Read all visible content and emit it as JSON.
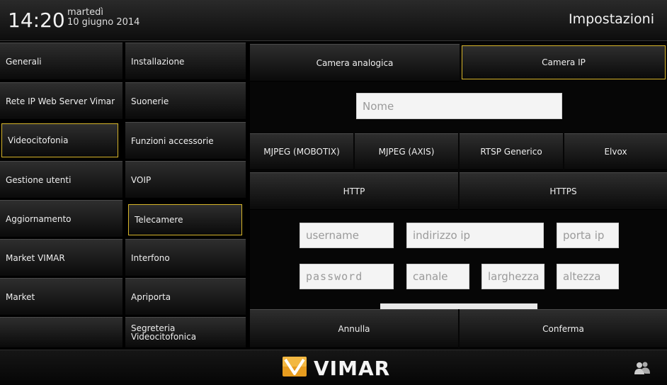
{
  "header": {
    "time": "14:20",
    "day_of_week": "martedì",
    "date": "10 giugno 2014",
    "title": "Impostazioni"
  },
  "menu_col1": [
    "Generali",
    "Rete IP Web Server Vimar",
    "Videocitofonia",
    "Gestione utenti",
    "Aggiornamento",
    "Market VIMAR",
    "Market"
  ],
  "menu_col2": [
    "Installazione",
    "Suonerie",
    "Funzioni accessorie",
    "VOIP",
    "Telecamere",
    "Interfono",
    "Apriporta",
    "Segreteria\nVideocitofonica"
  ],
  "camera_tabs": {
    "analog": "Camera analogica",
    "ip": "Camera IP"
  },
  "form": {
    "name_placeholder": "Nome",
    "codecs": [
      "MJPEG (MOBOTIX)",
      "MJPEG (AXIS)",
      "RTSP Generico",
      "Elvox"
    ],
    "protocols": [
      "HTTP",
      "HTTPS"
    ],
    "username_placeholder": "username",
    "ip_placeholder": "indirizzo ip",
    "port_placeholder": "porta ip",
    "password_placeholder": "password",
    "channel_placeholder": "canale",
    "width_placeholder": "larghezza",
    "height_placeholder": "altezza"
  },
  "actions": {
    "cancel": "Annulla",
    "confirm": "Conferma"
  },
  "footer": {
    "brand": "VIMAR"
  },
  "colors": {
    "selected_border": "#d7b52a",
    "background": "#000000"
  }
}
